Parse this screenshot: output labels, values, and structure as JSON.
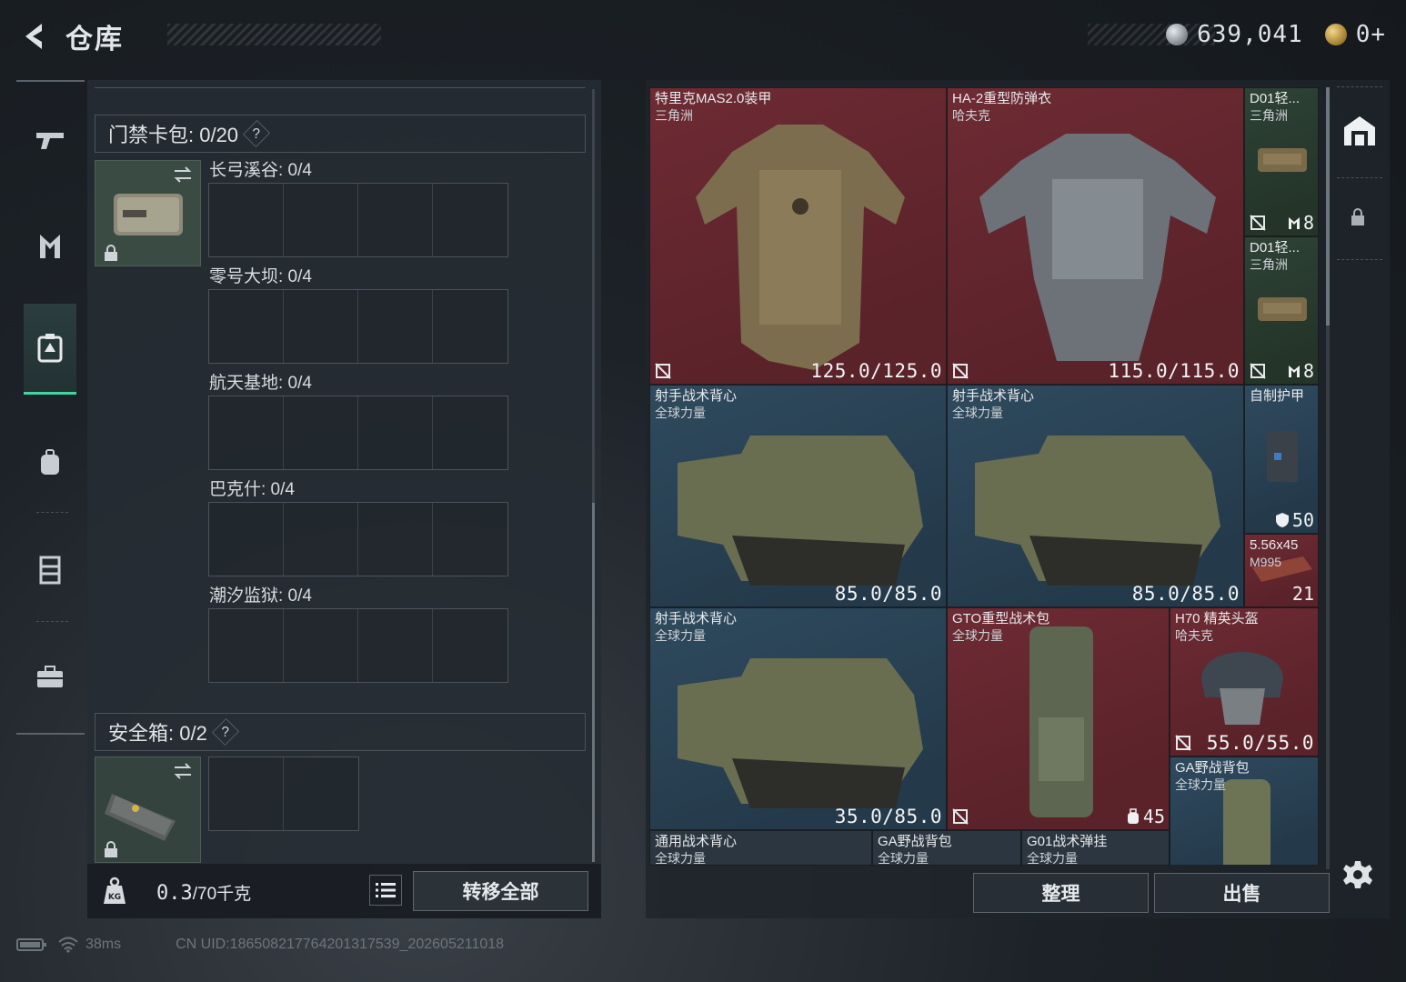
{
  "header": {
    "title": "仓库",
    "currency_silver": "639,041",
    "currency_gold": "0+"
  },
  "nav": {
    "items": [
      "firearms-icon",
      "parts-icon",
      "storage-icon",
      "backpack-icon",
      "vest-icon",
      "case-icon"
    ],
    "active": "storage-icon"
  },
  "left": {
    "keycard_header": "门禁卡包: 0/20",
    "slots": [
      {
        "label": "长弓溪谷: 0/4"
      },
      {
        "label": "零号大坝: 0/4"
      },
      {
        "label": "航天基地: 0/4"
      },
      {
        "label": "巴克什: 0/4"
      },
      {
        "label": "潮汐监狱: 0/4"
      }
    ],
    "safebox_header": "安全箱: 0/2",
    "help": "?",
    "weight": "0.3",
    "weight_max": "/70千克",
    "transfer_all": "转移全部"
  },
  "items": [
    {
      "name": "特里克MAS2.0装甲",
      "sub": "三角洲",
      "value": "125.0/125.0",
      "color": "red"
    },
    {
      "name": "HA-2重型防弹衣",
      "sub": "哈夫克",
      "value": "115.0/115.0",
      "color": "red"
    },
    {
      "name": "D01轻...",
      "sub": "三角洲",
      "value": "8",
      "color": "green"
    },
    {
      "name": "D01轻...",
      "sub": "三角洲",
      "value": "8",
      "color": "green"
    },
    {
      "name": "射手战术背心",
      "sub": "全球力量",
      "value": "85.0/85.0",
      "color": "blue"
    },
    {
      "name": "射手战术背心",
      "sub": "全球力量",
      "value": "85.0/85.0",
      "color": "blue"
    },
    {
      "name": "自制护甲",
      "sub": "",
      "value": "50",
      "color": "blue"
    },
    {
      "name": "5.56x45",
      "sub": "M995",
      "value": "21",
      "color": "red"
    },
    {
      "name": "射手战术背心",
      "sub": "全球力量",
      "value": "35.0/85.0",
      "color": "blue"
    },
    {
      "name": "GTO重型战术包",
      "sub": "全球力量",
      "value": "45",
      "color": "red"
    },
    {
      "name": "H70 精英头盔",
      "sub": "哈夫克",
      "value": "55.0/55.0",
      "color": "red"
    },
    {
      "name": "GA野战背包",
      "sub": "全球力量",
      "value": "",
      "color": "blue"
    },
    {
      "name": "通用战术背心",
      "sub": "全球力量",
      "value": "",
      "color": "blue"
    },
    {
      "name": "GA野战背包",
      "sub": "全球力量",
      "value": "",
      "color": "blue"
    },
    {
      "name": "G01战术弹挂",
      "sub": "全球力量",
      "value": "",
      "color": "blue"
    }
  ],
  "actions": {
    "sort": "整理",
    "sell": "出售"
  },
  "footer": {
    "ping": "38ms",
    "uid": "CN UID:18650821776420131753​9_202605211018"
  },
  "colors": {
    "accent": "#3fd6a0",
    "rarity_red": "#6e2b34",
    "rarity_blue": "#2f4a5e",
    "rarity_green": "#2e4236"
  }
}
